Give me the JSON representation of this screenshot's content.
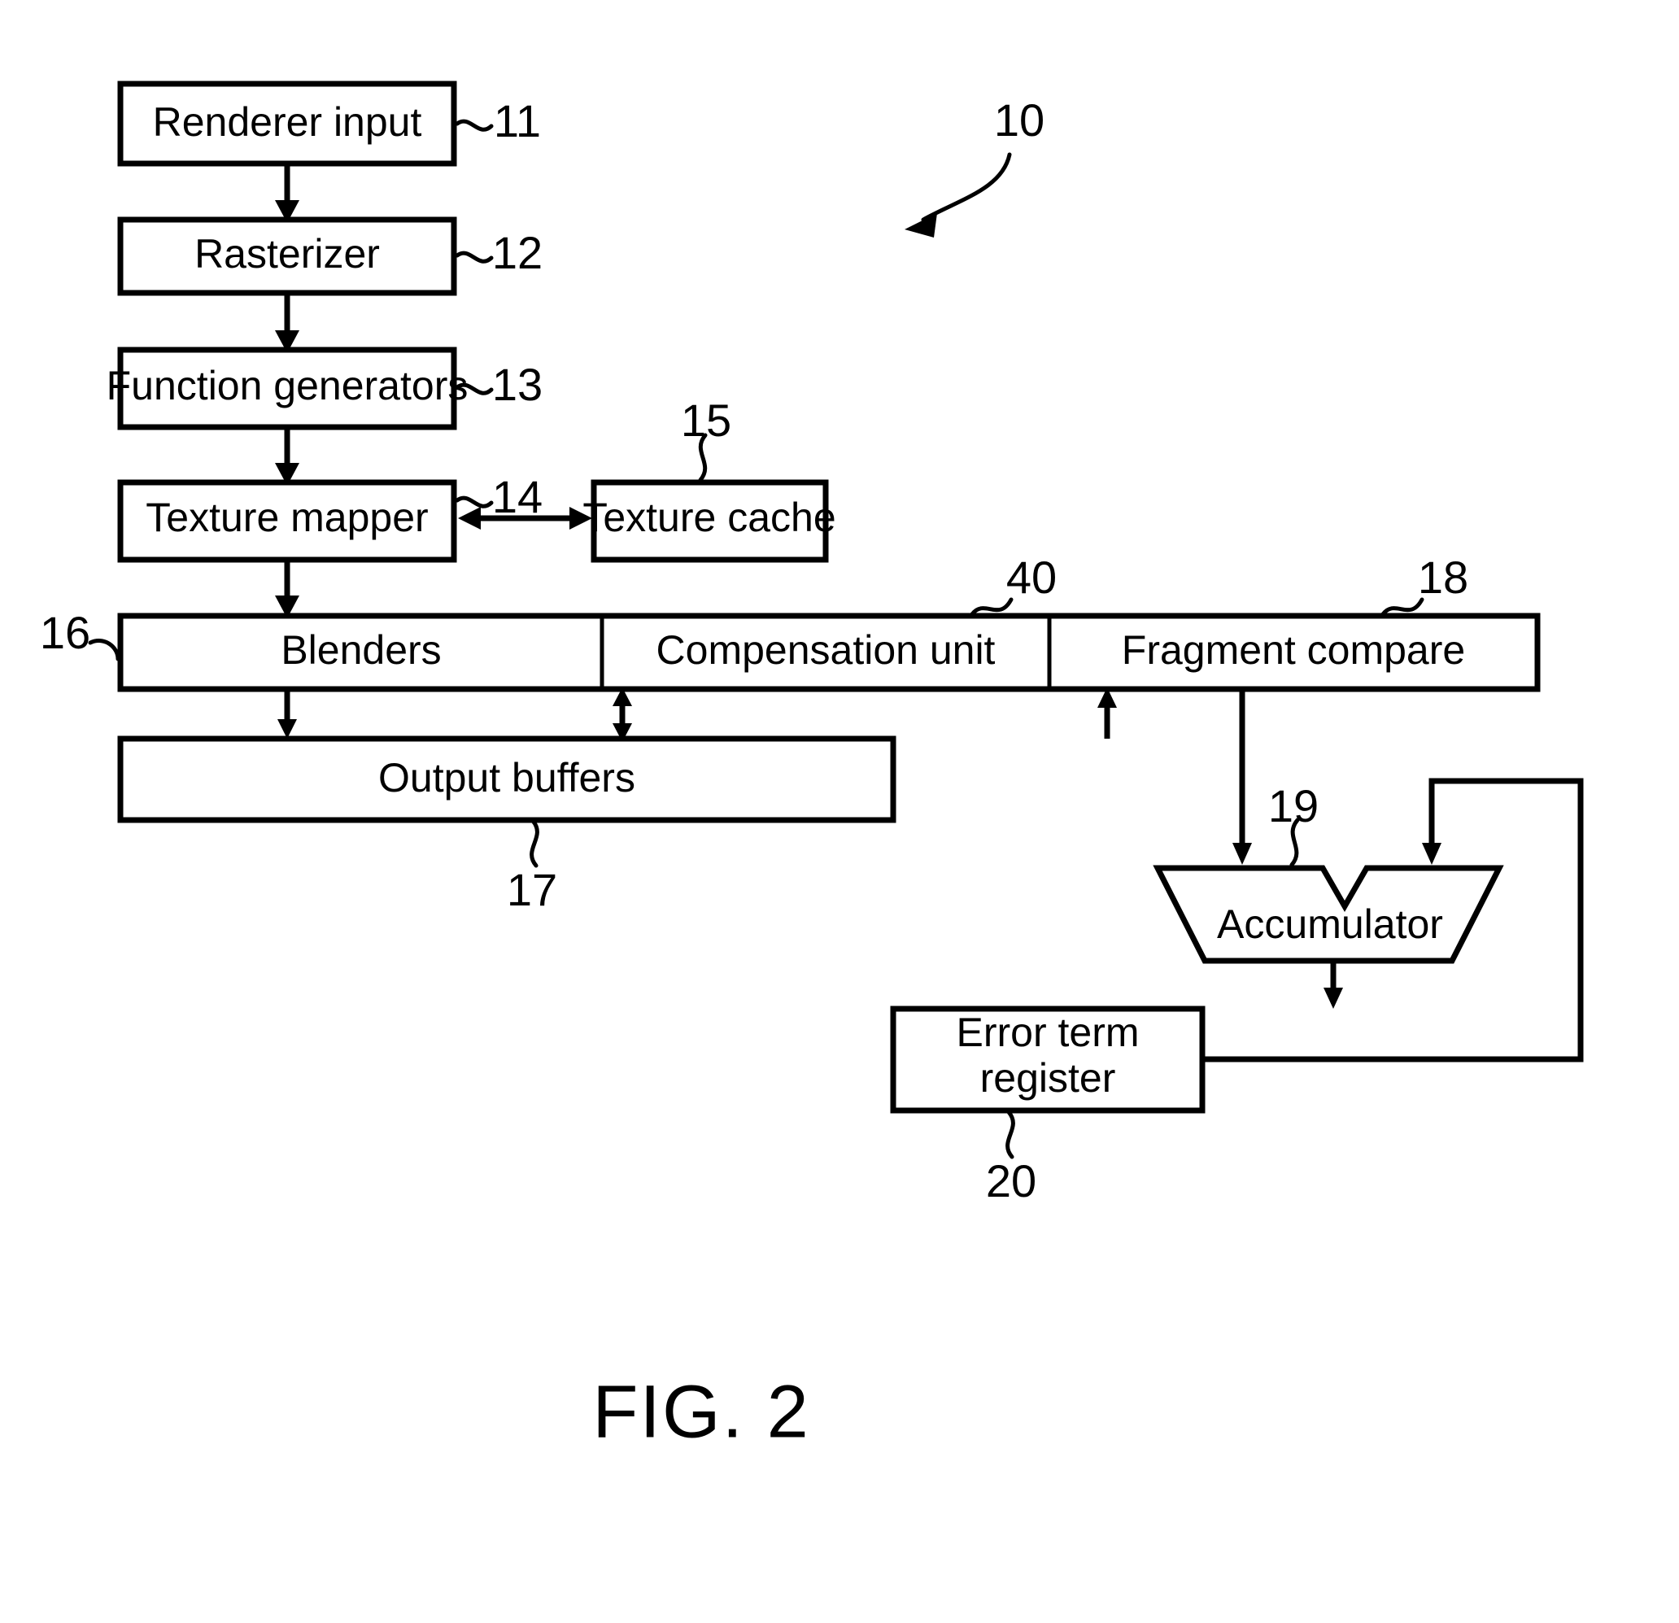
{
  "figure": {
    "caption": "FIG. 2",
    "system_ref": "10"
  },
  "blocks": [
    {
      "id": "renderer_input",
      "label": "Renderer input",
      "ref": "11"
    },
    {
      "id": "rasterizer",
      "label": "Rasterizer",
      "ref": "12"
    },
    {
      "id": "function_gens",
      "label": "Function generators",
      "ref": "13"
    },
    {
      "id": "texture_mapper",
      "label": "Texture mapper",
      "ref": "14"
    },
    {
      "id": "texture_cache",
      "label": "Texture cache",
      "ref": "15"
    },
    {
      "id": "blenders",
      "label": "Blenders",
      "ref": "16"
    },
    {
      "id": "compensation_unit",
      "label": "Compensation unit",
      "ref": "40"
    },
    {
      "id": "fragment_compare",
      "label": "Fragment compare",
      "ref": "18"
    },
    {
      "id": "output_buffers",
      "label": "Output buffers",
      "ref": "17"
    },
    {
      "id": "accumulator",
      "label": "Accumulator",
      "ref": "19"
    },
    {
      "id": "error_term_reg",
      "label_line1": "Error term",
      "label_line2": "register",
      "ref": "20"
    }
  ],
  "colors": {
    "ink": "#000000",
    "paper": "#ffffff"
  }
}
